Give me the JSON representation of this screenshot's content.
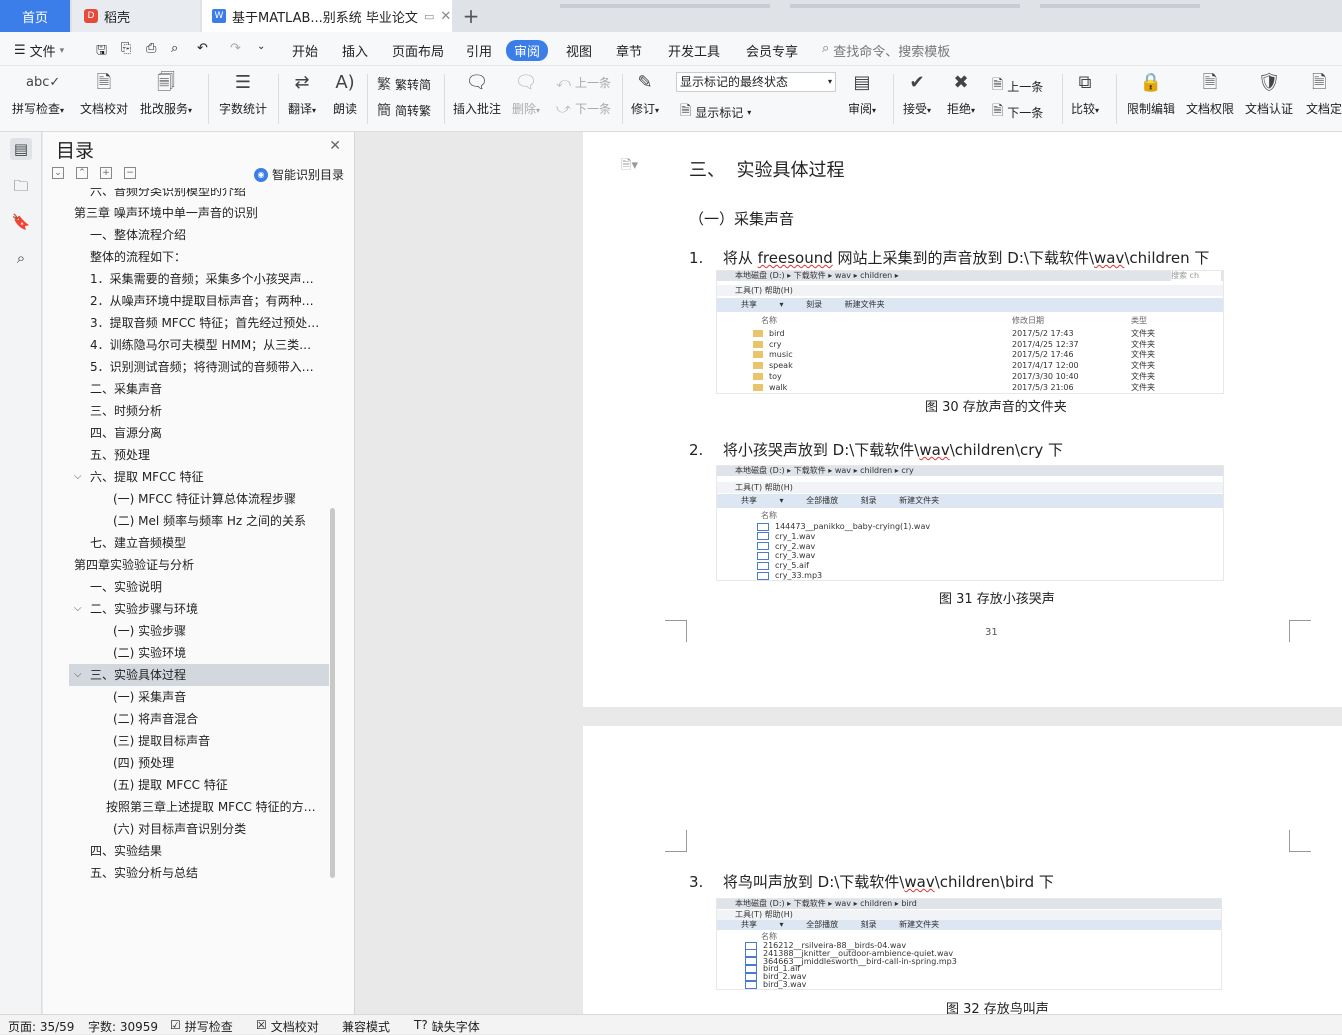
{
  "tabs": {
    "home": "首页",
    "daoke": "稻壳",
    "doc": "基于MATLAB...别系统 毕业论文",
    "new": "+"
  },
  "menu": {
    "file": "文件",
    "items": [
      "开始",
      "插入",
      "页面布局",
      "引用",
      "审阅",
      "视图",
      "章节",
      "开发工具",
      "会员专享"
    ],
    "search": "查找命令、搜索模板"
  },
  "ribbon": {
    "spell": "拼写检查",
    "proof": "文档校对",
    "batch": "批改服务",
    "wordcount": "字数统计",
    "translate": "翻译",
    "read": "朗读",
    "t2s": "繁转简",
    "s2t": "简转繁",
    "insert_comment": "插入批注",
    "delete": "删除",
    "prev": "上一条",
    "next": "下一条",
    "revise": "修订",
    "markup_state": "显示标记的最终状态",
    "show_markup": "显示标记",
    "review": "审阅",
    "accept": "接受",
    "reject": "拒绝",
    "prev2": "上一条",
    "next2": "下一条",
    "compare": "比较",
    "restrict": "限制编辑",
    "perm": "文档权限",
    "cert": "文档认证",
    "finalize": "文档定"
  },
  "toc": {
    "title": "目录",
    "smart": "智能识别目录",
    "items": [
      {
        "text": "六、音频分类识别模型的介绍",
        "level": 2
      },
      {
        "text": "第三章 噪声环境中单一声音的识别",
        "level": 1,
        "arrow": "v"
      },
      {
        "text": "一、整体流程介绍",
        "level": 2
      },
      {
        "text": "整体的流程如下：",
        "level": 2
      },
      {
        "text": "1．采集需要的音频；采集多个小孩哭声…",
        "level": 2
      },
      {
        "text": "2．从噪声环境中提取目标声音；有两种…",
        "level": 2
      },
      {
        "text": "3．提取音频 MFCC 特征；首先经过预处…",
        "level": 2
      },
      {
        "text": "4．训练隐马尔可夫模型 HMM；从三类…",
        "level": 2
      },
      {
        "text": "5．识别测试音频；将待测试的音频带入…",
        "level": 2
      },
      {
        "text": "二、采集声音",
        "level": 2
      },
      {
        "text": "三、时频分析",
        "level": 2
      },
      {
        "text": "四、盲源分离",
        "level": 2
      },
      {
        "text": "五、预处理",
        "level": 2
      },
      {
        "text": "六、提取 MFCC 特征",
        "level": 2,
        "arrow": "v"
      },
      {
        "text": "(一) MFCC 特征计算总体流程步骤",
        "level": 3
      },
      {
        "text": "(二) Mel 频率与频率 Hz 之间的关系",
        "level": 3
      },
      {
        "text": "七、建立音频模型",
        "level": 2
      },
      {
        "text": "第四章实验验证与分析",
        "level": 1,
        "arrow": "v"
      },
      {
        "text": "一、实验说明",
        "level": 2
      },
      {
        "text": "二、实验步骤与环境",
        "level": 2,
        "arrow": "v"
      },
      {
        "text": "(一) 实验步骤",
        "level": 3
      },
      {
        "text": "(二) 实验环境",
        "level": 3
      },
      {
        "text": "三、实验具体过程",
        "level": 2,
        "arrow": "v",
        "selected": true
      },
      {
        "text": "(一) 采集声音",
        "level": 3
      },
      {
        "text": "(二) 将声音混合",
        "level": 3
      },
      {
        "text": "(三) 提取目标声音",
        "level": 3
      },
      {
        "text": "(四) 预处理",
        "level": 3
      },
      {
        "text": "(五) 提取 MFCC 特征",
        "level": 3
      },
      {
        "text": "按照第三章上述提取 MFCC 特征的方…",
        "level": 2.5
      },
      {
        "text": "(六) 对目标声音识别分类",
        "level": 3
      },
      {
        "text": "四、实验结果",
        "level": 2
      },
      {
        "text": "五、实验分析与总结",
        "level": 2
      }
    ]
  },
  "doc": {
    "heading": "三、  实验具体过程",
    "subheading": "（一）采集声音",
    "step1_num": "1.",
    "step1_a": "将从 ",
    "step1_b": "freesound",
    "step1_c": " 网站上采集到的声音放到 D:\\下载软件\\",
    "step1_d": "wav",
    "step1_e": "\\children 下",
    "fig30": "图 30 存放声音的文件夹",
    "step2_num": "2.",
    "step2_a": "将小孩哭声放到 D:\\下载软件\\",
    "step2_d": "wav",
    "step2_e": "\\children\\cry 下",
    "fig31": "图 31 存放小孩哭声",
    "page_num": "31",
    "step3_num": "3.",
    "step3_a": "将鸟叫声放到 D:\\下载软件\\",
    "step3_d": "wav",
    "step3_e": "\\children\\bird 下",
    "fig32": "图 32 存放鸟叫声"
  },
  "explorer1": {
    "addr": "本地磁盘 (D:)  ▸  下载软件  ▸  wav  ▸  children  ▸",
    "search": "搜索 ch",
    "menu": "工具(T)      帮助(H)",
    "toolbar": "共享 ▾   刻录   新建文件夹",
    "cols": [
      "名称",
      "修改日期",
      "类型"
    ],
    "rows": [
      [
        "bird",
        "2017/5/2 17:43",
        "文件夹"
      ],
      [
        "cry",
        "2017/4/25 12:37",
        "文件夹"
      ],
      [
        "music",
        "2017/5/2 17:46",
        "文件夹"
      ],
      [
        "speak",
        "2017/4/17 12:00",
        "文件夹"
      ],
      [
        "toy",
        "2017/3/30 10:40",
        "文件夹"
      ],
      [
        "walk",
        "2017/5/3 21:06",
        "文件夹"
      ]
    ]
  },
  "explorer2": {
    "addr": "本地磁盘 (D:)  ▸  下载软件  ▸  wav  ▸  children  ▸  cry",
    "menu": "工具(T)      帮助(H)",
    "toolbar": "共享 ▾   全部播放   刻录   新建文件夹",
    "col": "名称",
    "rows": [
      "144473__panikko__baby-crying(1).wav",
      "cry_1.wav",
      "cry_2.wav",
      "cry_3.wav",
      "cry_5.aif",
      "cry_33.mp3"
    ]
  },
  "explorer3": {
    "addr": "本地磁盘 (D:)  ▸  下载软件  ▸  wav  ▸  children  ▸  bird",
    "menu": "工具(T)      帮助(H)",
    "toolbar": "共享 ▾   全部播放   刻录   新建文件夹",
    "col": "名称",
    "rows": [
      "216212__rsilveira-88__birds-04.wav",
      "241388__jknitter__outdoor-ambience-quiet.wav",
      "364663__jmiddlesworth__bird-call-in-spring.mp3",
      "bird_1.aif",
      "bird_2.wav",
      "bird_3.wav"
    ]
  },
  "status": {
    "page": "页面: 35/59",
    "words": "字数: 30959",
    "spell": "拼写检查",
    "proof": "文档校对",
    "compat": "兼容模式",
    "font": "缺失字体"
  }
}
